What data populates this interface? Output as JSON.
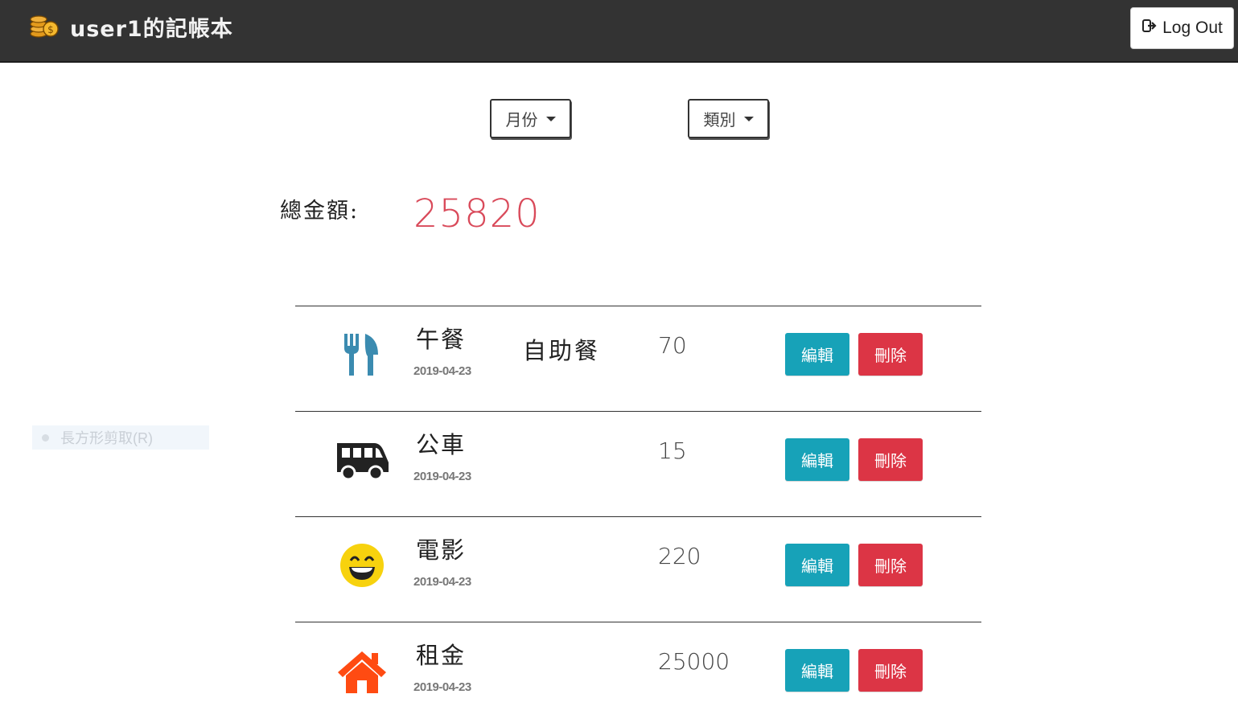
{
  "app": {
    "title": "user1的記帳本",
    "logout_label": "Log Out"
  },
  "filters": {
    "month_label": "月份",
    "category_label": "類別"
  },
  "summary": {
    "total_label": "總金額:",
    "total_amount": "25820"
  },
  "overlay": {
    "label": "長方形剪取(R)"
  },
  "colors": {
    "navbar": "#333333",
    "edit": "#17a2b8",
    "delete": "#dc3545",
    "total": "#d94a5a"
  },
  "records": [
    {
      "title": "午餐",
      "date": "2019-04-23",
      "note": "自助餐",
      "amount": "70",
      "icon": "utensils-icon",
      "edit_label": "編輯",
      "delete_label": "刪除"
    },
    {
      "title": "公車",
      "date": "2019-04-23",
      "note": "",
      "amount": "15",
      "icon": "bus-icon",
      "edit_label": "編輯",
      "delete_label": "刪除"
    },
    {
      "title": "電影",
      "date": "2019-04-23",
      "note": "",
      "amount": "220",
      "icon": "smile-icon",
      "edit_label": "編輯",
      "delete_label": "刪除"
    },
    {
      "title": "租金",
      "date": "2019-04-23",
      "note": "",
      "amount": "25000",
      "icon": "home-icon",
      "edit_label": "編輯",
      "delete_label": "刪除"
    }
  ]
}
